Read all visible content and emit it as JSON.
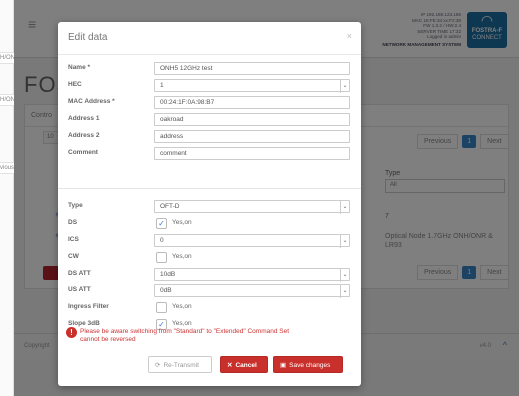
{
  "left_strip": {
    "fragments": [
      "H/ON",
      "H/ON",
      "vious"
    ]
  },
  "background": {
    "page_title": "FOS",
    "panel_label": "Contro",
    "input_chip": "10",
    "sysinfo": {
      "lines": [
        "IP 192.168.123.156",
        "MAC 18:FE:34:xx:F2:38",
        "FW 1.3.2 / HW:2.4",
        "SERVER TIME 17:32",
        "Logged in admin"
      ],
      "title": "NETWORK MANAGEMENT SYSTEM"
    },
    "logo": {
      "line1": "FOSTRA-F",
      "line2": "CONNECT"
    },
    "type_column": {
      "label": "Type",
      "value": "All"
    },
    "pagination_top": {
      "previous": "Previous",
      "page": "1",
      "next": "Next"
    },
    "pagination_bottom": {
      "previous": "Previous",
      "page": "1",
      "next": "Next"
    },
    "row1_num": "7",
    "row2_desc": "Optical Node 1.7GHz ONH/ONR & LR93",
    "footer_left": "Copyright",
    "footer_version": "v4.0",
    "footer_up": "^"
  },
  "modal": {
    "title": "Edit data",
    "close": "×",
    "fields": {
      "name": {
        "label": "Name *",
        "value": "ONH5 12GHz test"
      },
      "hec": {
        "label": "HEC",
        "value": "1"
      },
      "mac": {
        "label": "MAC Address *",
        "value": "00:24:1F:0A:98:B7"
      },
      "address1": {
        "label": "Address 1",
        "value": "oakroad"
      },
      "address2": {
        "label": "Address 2",
        "value": "address"
      },
      "comment": {
        "label": "Comment",
        "value": "comment"
      },
      "type": {
        "label": "Type",
        "value": "OFT-D"
      },
      "ds": {
        "label": "DS",
        "text": "Yes,on",
        "checked": true
      },
      "ics": {
        "label": "ICS",
        "value": "0"
      },
      "cw": {
        "label": "CW",
        "text": "Yes,on",
        "checked": false
      },
      "ds_att": {
        "label": "DS ATT",
        "value": "10dB"
      },
      "us_att": {
        "label": "US ATT",
        "value": "0dB"
      },
      "ingress": {
        "label": "Ingress Filter",
        "text": "Yes,on",
        "checked": false
      },
      "slope": {
        "label": "Slope 3dB",
        "text": "Yes,on",
        "checked": true
      }
    },
    "warning": {
      "line1": "Please be aware switching from \"Standard\" to \"Extended\" Command Set",
      "line2": "cannot be reversed"
    },
    "buttons": {
      "retransmit": "Re-Transmit",
      "cancel": "Cancel",
      "save": "Save changes"
    },
    "icons": {
      "check": "✓",
      "arrow": "⌄"
    }
  }
}
